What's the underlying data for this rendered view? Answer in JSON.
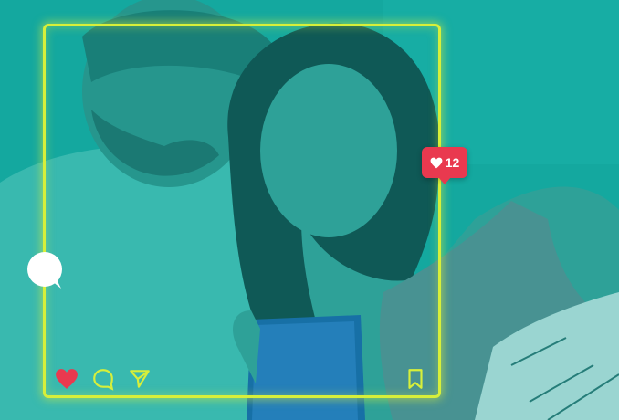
{
  "like_badge": {
    "count": "12",
    "color": "#e9394f"
  },
  "frame": {
    "color": "#d7ef3a"
  },
  "overlay": {
    "tint": "#13aaa1"
  },
  "icons": {
    "heart": "heart-icon",
    "comment": "comment-icon",
    "share": "send-icon",
    "bookmark": "bookmark-icon",
    "bubble": "chat-bubble-icon"
  }
}
